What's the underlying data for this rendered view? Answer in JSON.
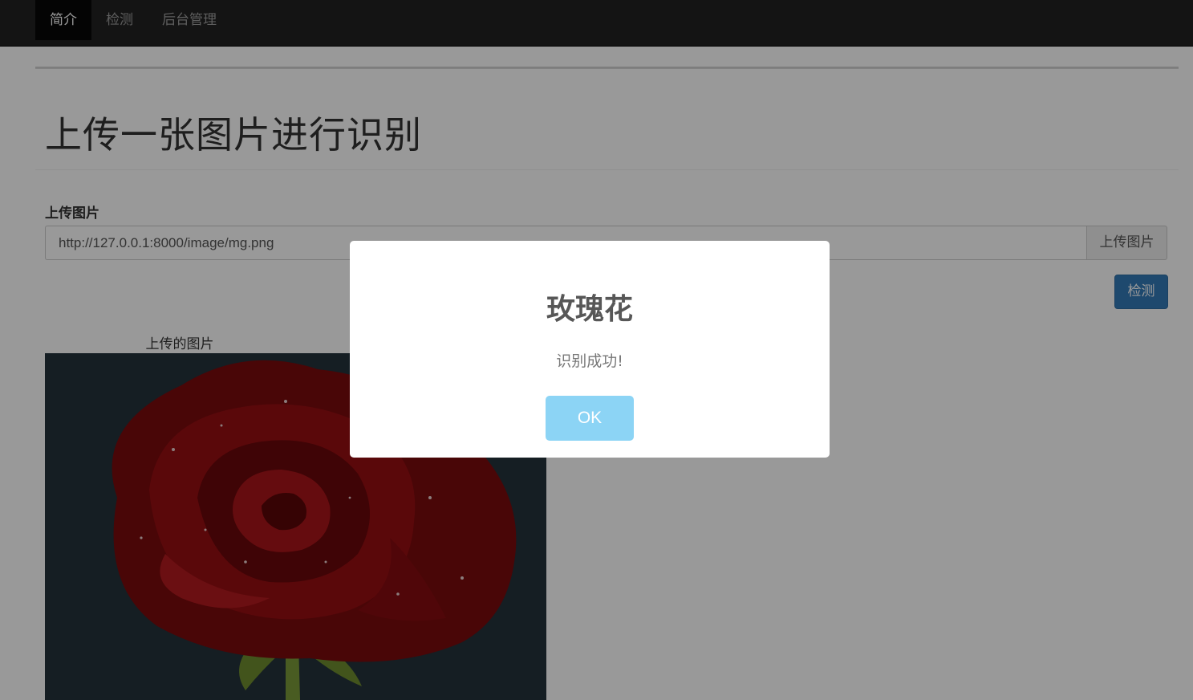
{
  "nav": {
    "items": [
      {
        "label": "简介",
        "active": true
      },
      {
        "label": "检测",
        "active": false
      },
      {
        "label": "后台管理",
        "active": false
      }
    ]
  },
  "main": {
    "title": "上传一张图片进行识别",
    "upload_label": "上传图片",
    "url_value": "http://127.0.0.1:8000/image/mg.png",
    "upload_button": "上传图片",
    "detect_button": "检测",
    "image_caption": "上传的图片"
  },
  "modal": {
    "title": "玫瑰花",
    "message": "识别成功!",
    "ok_label": "OK"
  },
  "colors": {
    "navbar": "#222222",
    "primary_button": "#337ab7",
    "ok_button": "#8cd4f5"
  }
}
